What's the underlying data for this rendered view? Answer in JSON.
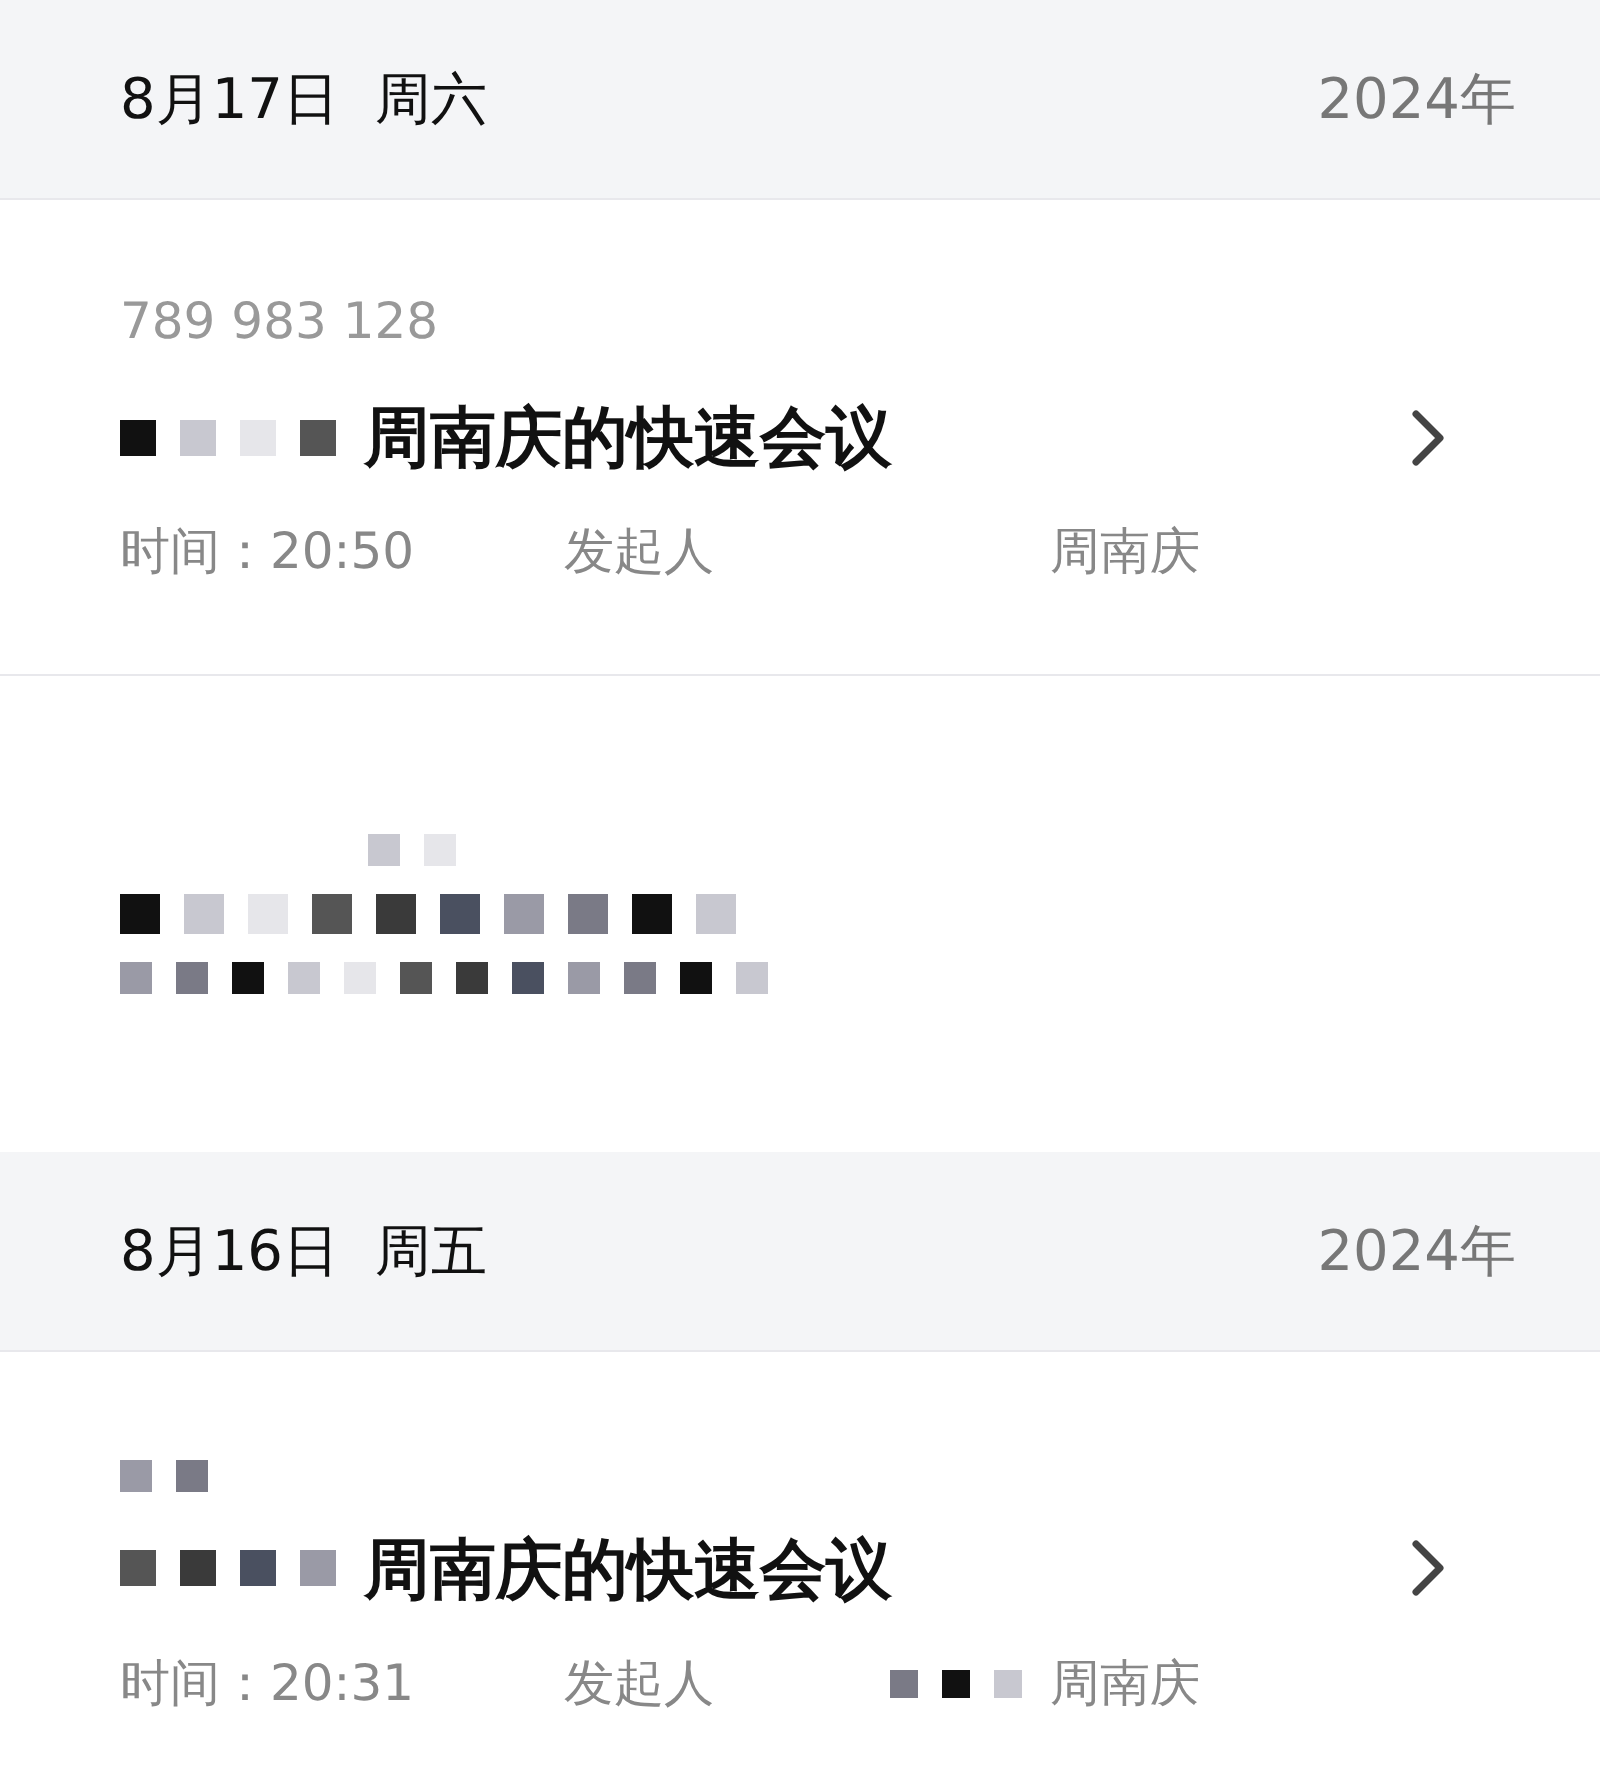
{
  "sections": [
    {
      "date": "8月17日",
      "weekday": "周六",
      "year": "2024年",
      "meetings": [
        {
          "kind": "meeting",
          "number": "789 983 128",
          "title": "周南庆的快速会议",
          "title_redacted": true,
          "time": "时间：20:50",
          "host_label": "发起人",
          "host": "周南庆",
          "host_redacted": false,
          "chevron": true
        },
        {
          "kind": "redacted"
        }
      ]
    },
    {
      "date": "8月16日",
      "weekday": "周五",
      "year": "2024年",
      "meetings": [
        {
          "kind": "meeting",
          "title": "周南庆的快速会议",
          "title_redacted": true,
          "time": "时间：20:31",
          "host_label": "发起人",
          "host": "周南庆",
          "host_redacted": true,
          "chevron": true
        }
      ]
    }
  ]
}
